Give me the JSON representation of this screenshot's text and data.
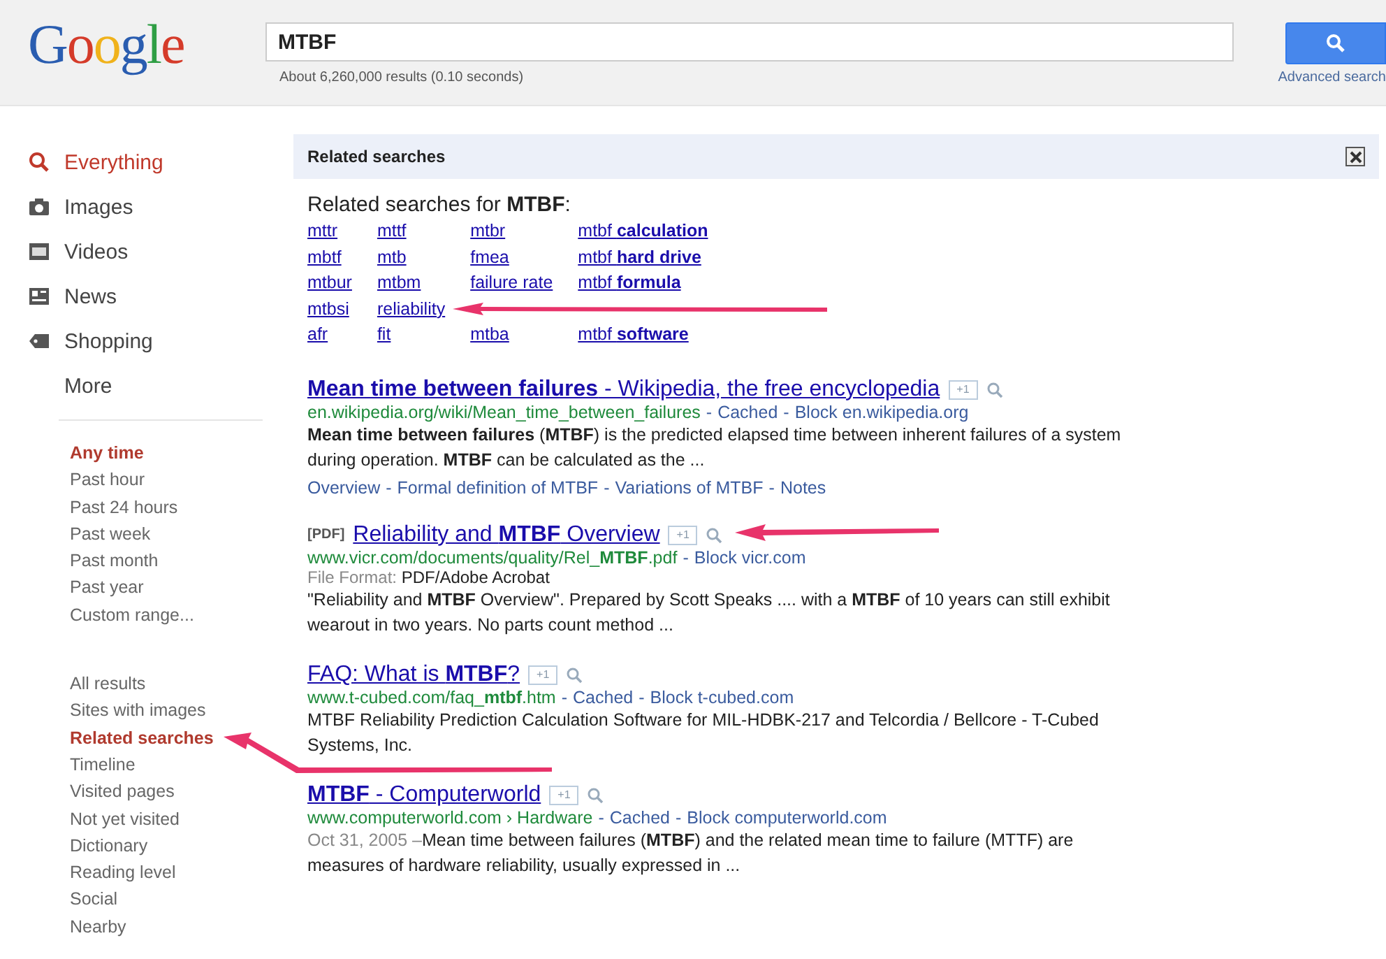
{
  "header": {
    "logo": "Google",
    "query": "MTBF",
    "result_stats": "About 6,260,000 results (0.10 seconds)",
    "advanced_link": "Advanced search"
  },
  "sidebar": {
    "modes": [
      {
        "label": "Everything",
        "kind": "search",
        "selected": true
      },
      {
        "label": "Images",
        "kind": "camera",
        "selected": false
      },
      {
        "label": "Videos",
        "kind": "film",
        "selected": false
      },
      {
        "label": "News",
        "kind": "news",
        "selected": false
      },
      {
        "label": "Shopping",
        "kind": "tag",
        "selected": false
      },
      {
        "label": "More",
        "kind": "none",
        "selected": false
      }
    ],
    "time_filters": [
      {
        "label": "Any time",
        "selected": true
      },
      {
        "label": "Past hour",
        "selected": false
      },
      {
        "label": "Past 24 hours",
        "selected": false
      },
      {
        "label": "Past week",
        "selected": false
      },
      {
        "label": "Past month",
        "selected": false
      },
      {
        "label": "Past year",
        "selected": false
      },
      {
        "label": "Custom range...",
        "selected": false
      }
    ],
    "result_filters": [
      {
        "label": "All results",
        "selected": false
      },
      {
        "label": "Sites with images",
        "selected": false
      },
      {
        "label": "Related searches",
        "selected": true
      },
      {
        "label": "Timeline",
        "selected": false
      },
      {
        "label": "Visited pages",
        "selected": false
      },
      {
        "label": "Not yet visited",
        "selected": false
      },
      {
        "label": "Dictionary",
        "selected": false
      },
      {
        "label": "Reading level",
        "selected": false
      },
      {
        "label": "Social",
        "selected": false
      },
      {
        "label": "Nearby",
        "selected": false
      }
    ]
  },
  "related": {
    "bar_title": "Related searches",
    "heading": "Related searches for **MTBF**:",
    "columns": [
      [
        "mttr",
        "mbtf",
        "mtbur",
        "mtbsi",
        "afr"
      ],
      [
        "mttf",
        "mtb",
        "mtbm",
        "reliability",
        "fit"
      ],
      [
        "mtbr",
        "fmea",
        "failure rate",
        null,
        "mtba"
      ],
      [
        "mtbf **calculation**",
        "mtbf **hard drive**",
        "mtbf **formula**",
        null,
        "mtbf **software**"
      ]
    ]
  },
  "results": [
    {
      "title": "**Mean time between failures** - Wikipedia, the free encyclopedia",
      "plus_one": "+1",
      "url": "en.wikipedia.org/wiki/Mean_time_between_failures",
      "links": [
        {
          "sep": "-",
          "label": "Cached"
        },
        {
          "sep": "-",
          "label": "Block en.wikipedia.org"
        }
      ],
      "snippet": "**Mean time between failures** (**MTBF**) is the predicted elapsed time between inherent failures of a system during operation. **MTBF** can be calculated as the ...",
      "sitelinks": [
        {
          "label": "Overview"
        },
        {
          "sep": "-",
          "label": "Formal definition of MTBF"
        },
        {
          "sep": "-",
          "label": "Variations of MTBF"
        },
        {
          "sep": "-",
          "label": "Notes"
        }
      ]
    },
    {
      "tag": "[PDF]",
      "title": "Reliability and **MTBF** Overview",
      "plus_one": "+1",
      "url": "www.vicr.com/documents/quality/Rel_**MTBF**.pdf",
      "links": [
        {
          "sep": "-",
          "label": "Block vicr.com"
        }
      ],
      "file_format_label": "File Format:",
      "file_format": "PDF/Adobe Acrobat",
      "snippet": "\"Reliability and **MTBF** Overview\". Prepared by Scott Speaks .... with a **MTBF** of 10 years can still exhibit wearout in two years. No parts count method ..."
    },
    {
      "title": "FAQ: What is **MTBF**?",
      "plus_one": "+1",
      "url": "www.t-cubed.com/faq_**mtbf**.htm",
      "links": [
        {
          "sep": "-",
          "label": "Cached"
        },
        {
          "sep": "-",
          "label": "Block t-cubed.com"
        }
      ],
      "snippet": "MTBF Reliability Prediction Calculation Software for MIL-HDBK-217 and Telcordia / Bellcore - T-Cubed Systems, Inc."
    },
    {
      "title": "**MTBF** - Computerworld",
      "plus_one": "+1",
      "url": "www.computerworld.com › Hardware",
      "links": [
        {
          "sep": "-",
          "label": "Cached"
        },
        {
          "sep": "-",
          "label": "Block computerworld.com"
        }
      ],
      "date": "Oct 31, 2005 –",
      "snippet": "Mean time between failures (**MTBF**) and the related mean time to failure (MTTF) are measures of hardware reliability, usually expressed in ..."
    }
  ]
}
